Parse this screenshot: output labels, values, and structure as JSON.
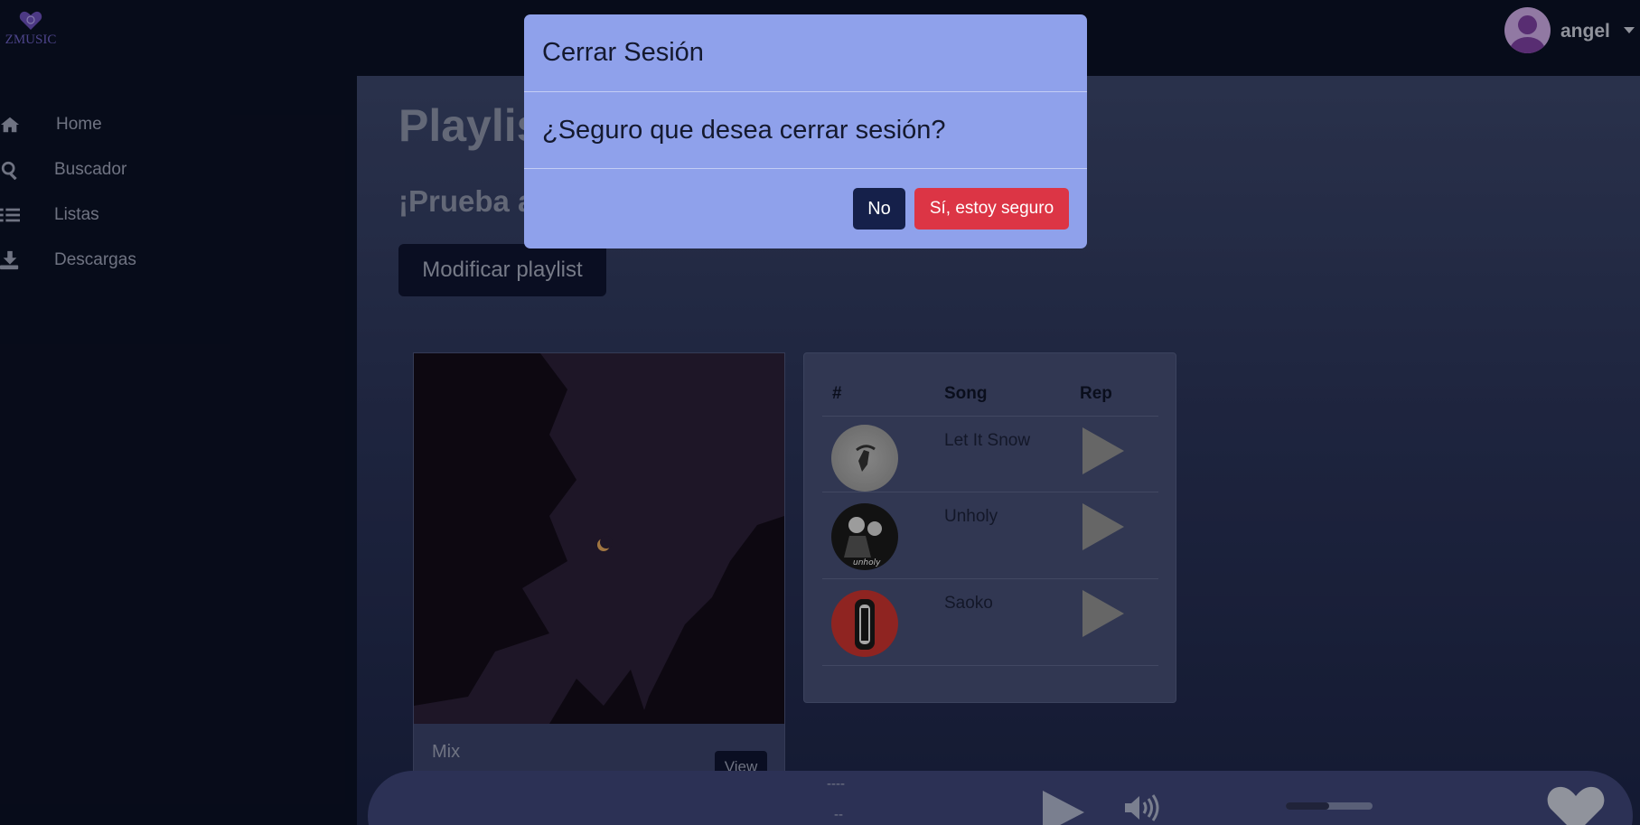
{
  "app": {
    "logo_text": "ZMUSIC"
  },
  "user": {
    "name": "angel"
  },
  "sidebar": {
    "items": [
      {
        "label": "Home",
        "icon": "home-icon"
      },
      {
        "label": "Buscador",
        "icon": "search-icon"
      },
      {
        "label": "Listas",
        "icon": "list-icon"
      },
      {
        "label": "Descargas",
        "icon": "download-icon"
      }
    ]
  },
  "main": {
    "title": "Playlis",
    "subtitle": "¡Prueba a",
    "modify_label": "Modificar playlist",
    "card": {
      "name": "Mix",
      "view_label": "View"
    },
    "songs": {
      "headers": [
        "#",
        "Song",
        "Rep"
      ],
      "rows": [
        {
          "title": "Let It Snow"
        },
        {
          "title": "Unholy"
        },
        {
          "title": "Saoko"
        }
      ]
    }
  },
  "player": {
    "title": "----",
    "artist": "--",
    "volume": 0.5
  },
  "modal": {
    "title": "Cerrar Sesión",
    "message": "¿Seguro que desea cerrar sesión?",
    "no_label": "No",
    "yes_label": "Sí, estoy seguro"
  },
  "colors": {
    "background": "#0b1124",
    "modal": "#8fa1eb",
    "danger": "#dc3545",
    "dark_button": "#15204a"
  }
}
